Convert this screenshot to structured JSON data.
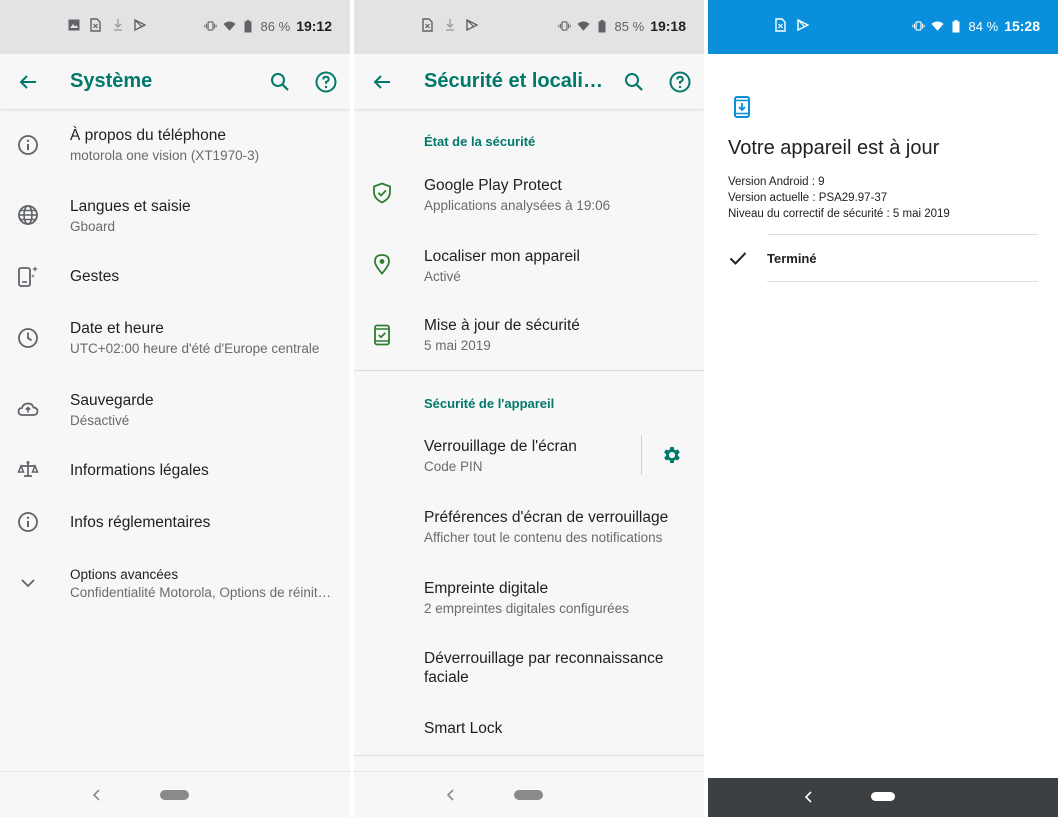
{
  "colors": {
    "accent": "#00796b",
    "status_blue": "#0a8fdc",
    "icon_green": "#2e7d32"
  },
  "panel1": {
    "status": {
      "battery": "86 %",
      "time": "19:12"
    },
    "title": "Système",
    "items": [
      {
        "icon": "info-icon",
        "title": "À propos du téléphone",
        "subtitle": "motorola one vision (XT1970-3)"
      },
      {
        "icon": "globe-icon",
        "title": "Langues et saisie",
        "subtitle": "Gboard"
      },
      {
        "icon": "gestures-icon",
        "title": "Gestes",
        "subtitle": ""
      },
      {
        "icon": "clock-icon",
        "title": "Date et heure",
        "subtitle": "UTC+02:00 heure d'été d'Europe centrale"
      },
      {
        "icon": "cloud-upload-icon",
        "title": "Sauvegarde",
        "subtitle": "Désactivé"
      },
      {
        "icon": "scale-icon",
        "title": "Informations légales",
        "subtitle": ""
      },
      {
        "icon": "info-icon",
        "title": "Infos réglementaires",
        "subtitle": ""
      },
      {
        "icon": "chevron-down-icon",
        "title": "Options avancées",
        "subtitle": "Confidentialité Motorola, Options de réinitialisation"
      }
    ]
  },
  "panel2": {
    "status": {
      "battery": "85 %",
      "time": "19:18"
    },
    "title": "Sécurité et localisation",
    "section1": "État de la sécurité",
    "section2": "Sécurité de l'appareil",
    "items1": [
      {
        "icon": "shield-check-icon",
        "title": "Google Play Protect",
        "subtitle": "Applications analysées à 19:06"
      },
      {
        "icon": "location-pin-icon",
        "title": "Localiser mon appareil",
        "subtitle": "Activé"
      },
      {
        "icon": "security-update-icon",
        "title": "Mise à jour de sécurité",
        "subtitle": "5 mai 2019"
      }
    ],
    "items2": [
      {
        "title": "Verrouillage de l'écran",
        "subtitle": "Code PIN"
      },
      {
        "title": "Préférences d'écran de verrouillage",
        "subtitle": "Afficher tout le contenu des notifications"
      },
      {
        "title": "Empreinte digitale",
        "subtitle": "2 empreintes digitales configurées"
      },
      {
        "title": "Déverrouillage par reconnaissance faciale",
        "subtitle": ""
      },
      {
        "title": "Smart Lock",
        "subtitle": ""
      }
    ],
    "face_line1": "Déverrouillage par reconnaissance",
    "face_line2": "faciale"
  },
  "panel3": {
    "status": {
      "battery": "84 %",
      "time": "15:28"
    },
    "title": "Votre appareil est à jour",
    "android_version": "Version Android : 9",
    "current_version": "Version actuelle : PSA29.97-37",
    "patch_level": "Niveau du correctif de sécurité : 5 mai 2019",
    "done_label": "Terminé"
  }
}
